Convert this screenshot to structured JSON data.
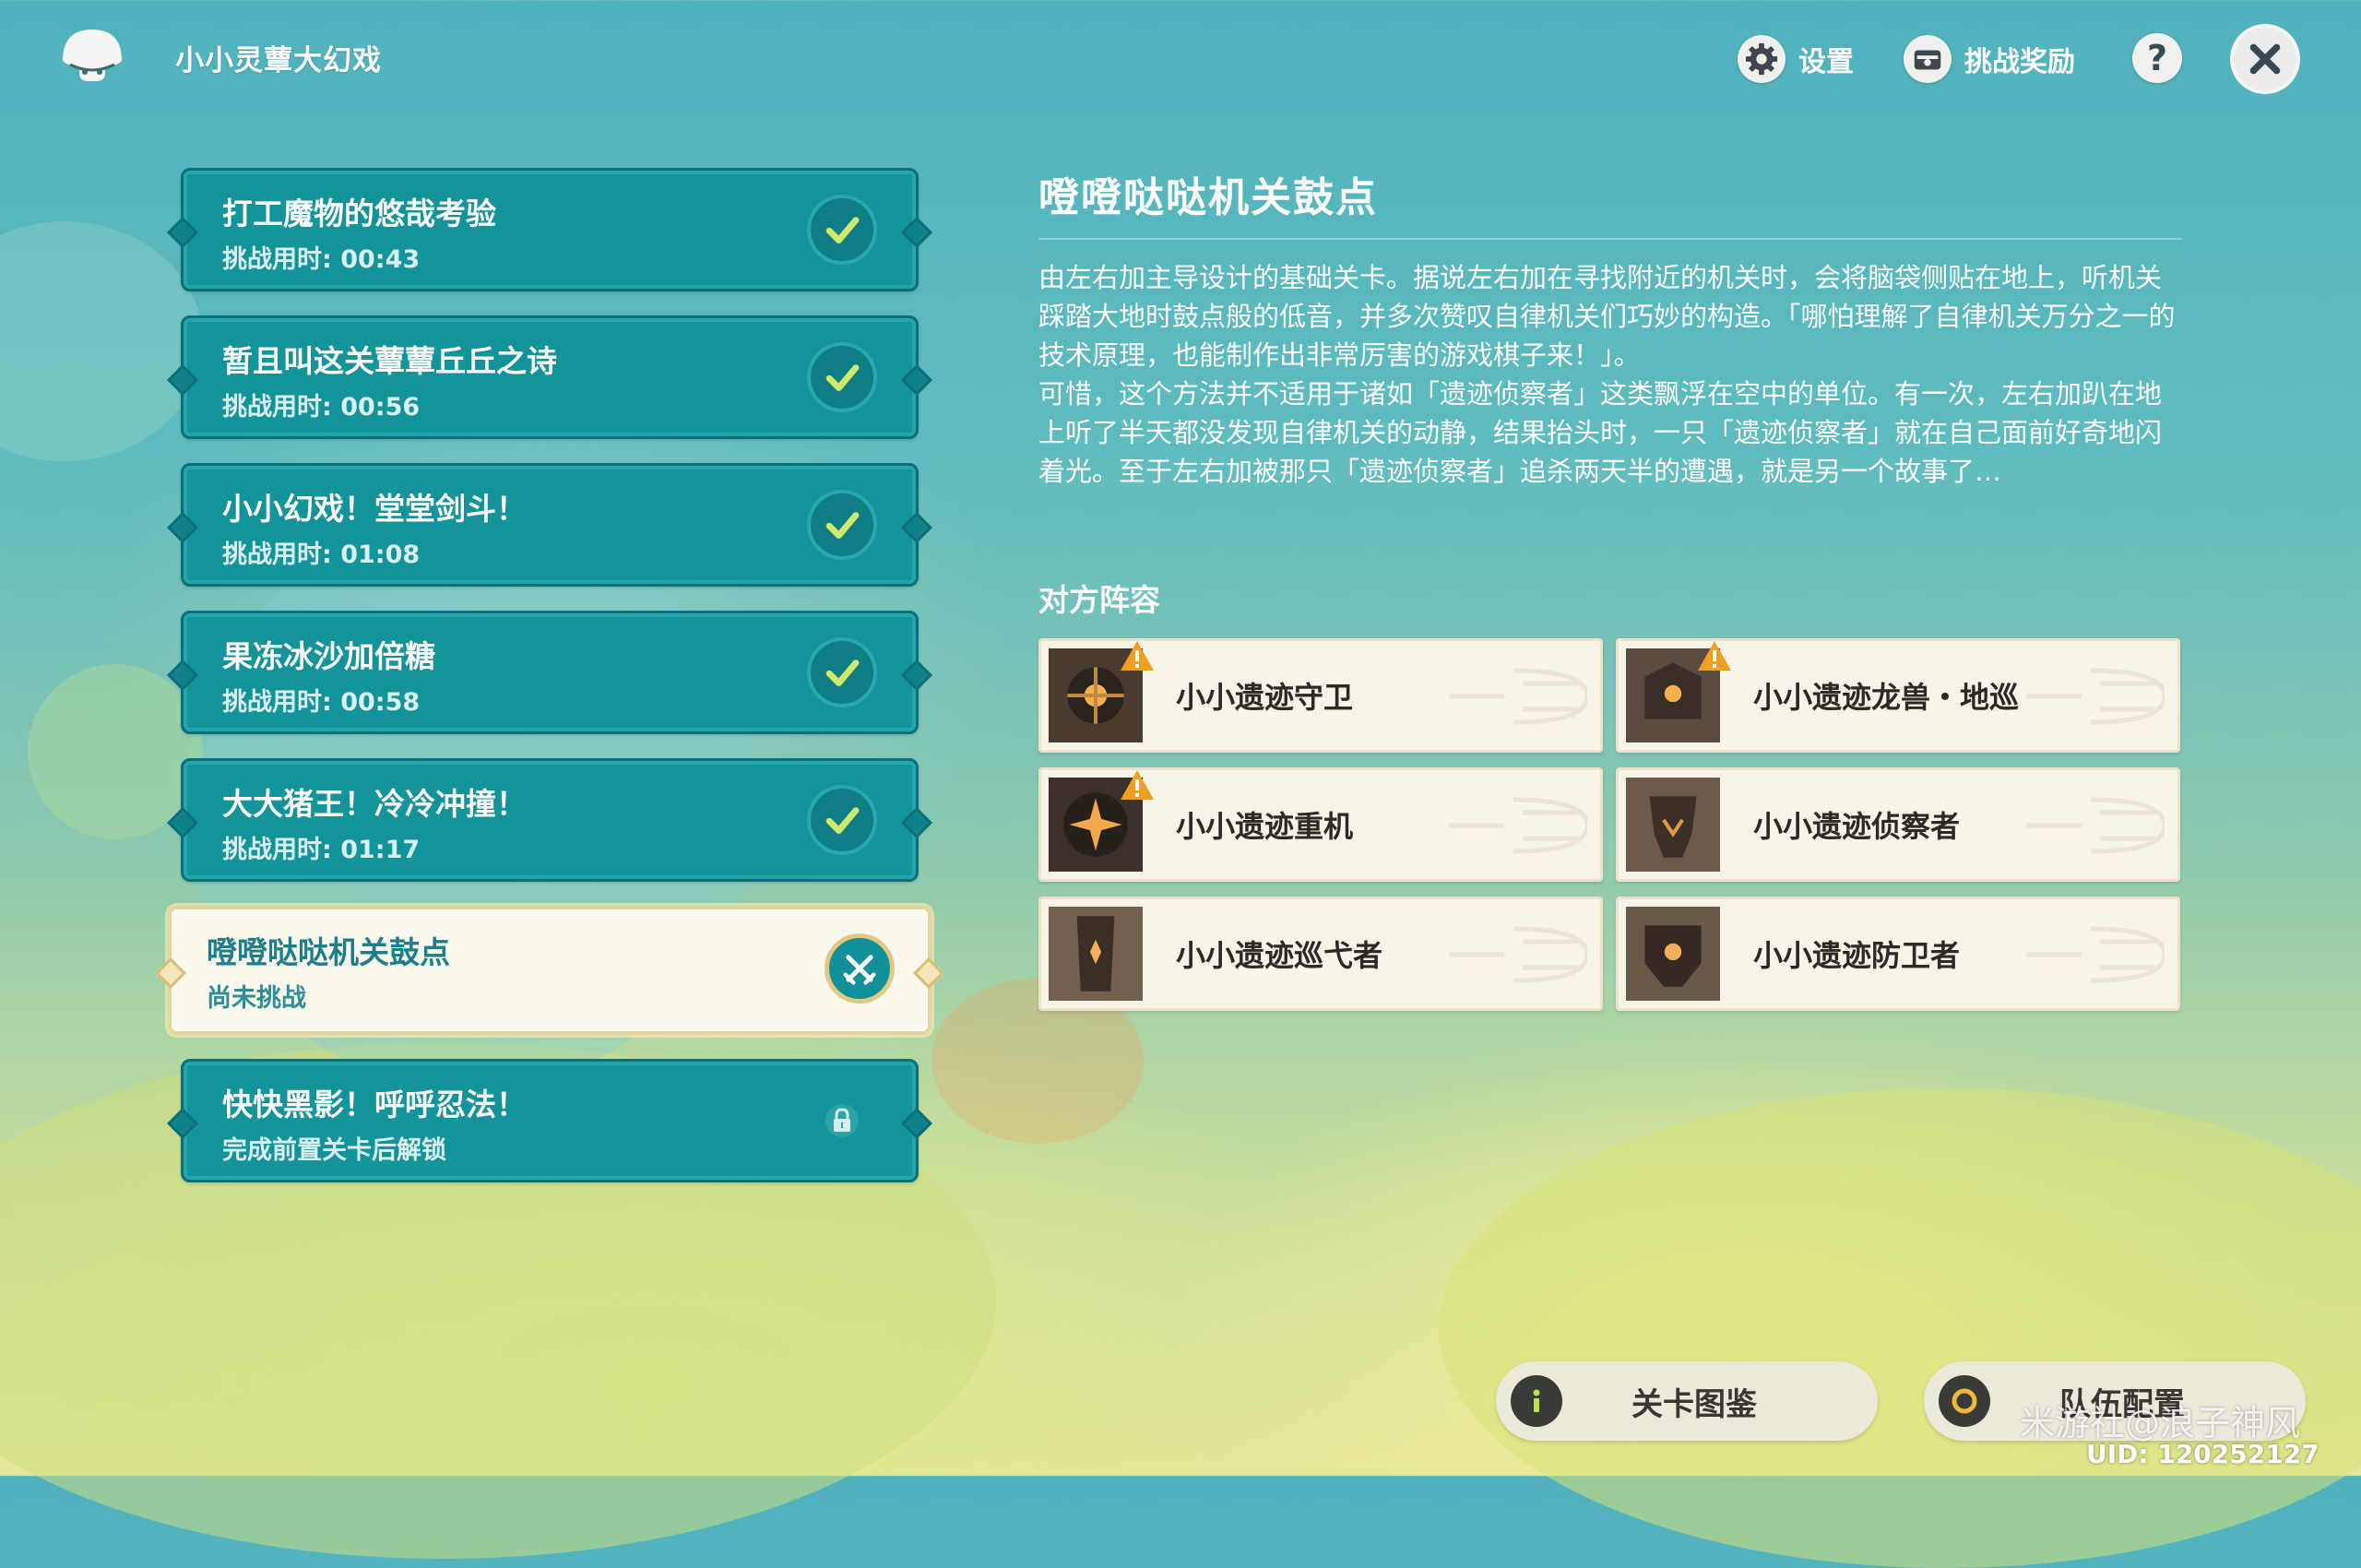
{
  "header": {
    "title": "小小灵蕈大幻戏",
    "settings_label": "设置",
    "rewards_label": "挑战奖励",
    "help_symbol": "?"
  },
  "levels": [
    {
      "name": "打工魔物的悠哉考验",
      "sub": "挑战用时: 00:43",
      "state": "completed"
    },
    {
      "name": "暂且叫这关蕈蕈丘丘之诗",
      "sub": "挑战用时: 00:56",
      "state": "completed"
    },
    {
      "name": "小小幻戏！堂堂剑斗！",
      "sub": "挑战用时: 01:08",
      "state": "completed"
    },
    {
      "name": "果冻冰沙加倍糖",
      "sub": "挑战用时: 00:58",
      "state": "completed"
    },
    {
      "name": "大大猪王！冷冷冲撞！",
      "sub": "挑战用时: 01:17",
      "state": "completed"
    },
    {
      "name": "噔噔哒哒机关鼓点",
      "sub": "尚未挑战",
      "state": "selected"
    },
    {
      "name": "快快黑影！呼呼忍法！",
      "sub": "完成前置关卡后解锁",
      "state": "locked"
    }
  ],
  "detail": {
    "title": "噔噔哒哒机关鼓点",
    "desc_p1": "由左右加主导设计的基础关卡。据说左右加在寻找附近的机关时，会将脑袋侧贴在地上，听机关踩踏大地时鼓点般的低音，并多次赞叹自律机关们巧妙的构造。「哪怕理解了自律机关万分之一的技术原理，也能制作出非常厉害的游戏棋子来！」。",
    "desc_p2": "可惜，这个方法并不适用于诸如「遗迹侦察者」这类飘浮在空中的单位。有一次，左右加趴在地上听了半天都没发现自律机关的动静，结果抬头时，一只「遗迹侦察者」就在自己面前好奇地闪着光。至于左右加被那只「遗迹侦察者」追杀两天半的遭遇，就是另一个故事了…",
    "enemy_header": "对方阵容",
    "enemies": [
      {
        "name": "小小遗迹守卫",
        "warning": true
      },
      {
        "name": "小小遗迹龙兽・地巡",
        "warning": true
      },
      {
        "name": "小小遗迹重机",
        "warning": true
      },
      {
        "name": "小小遗迹侦察者",
        "warning": false
      },
      {
        "name": "小小遗迹巡弋者",
        "warning": false
      },
      {
        "name": "小小遗迹防卫者",
        "warning": false
      }
    ]
  },
  "bottom": {
    "catalog_label": "关卡图鉴",
    "team_label": "队伍配置"
  },
  "watermark": "米游社@浪子神风",
  "uid": "UID: 120252127",
  "colors": {
    "panel_teal": "#13939a",
    "selected_bg": "#fbf8ee",
    "gold_border": "#e2c982",
    "check_green": "#cdea6a",
    "warning_orange": "#f0a020"
  }
}
